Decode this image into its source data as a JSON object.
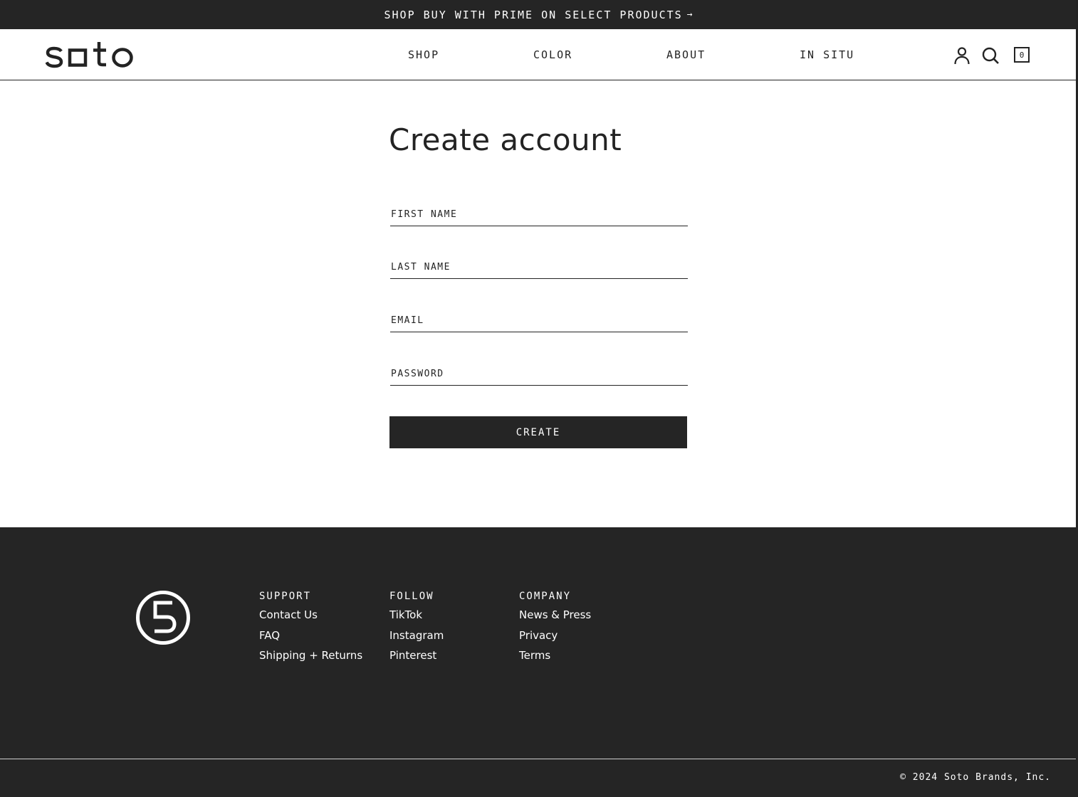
{
  "announcement": {
    "text": "SHOP BUY WITH PRIME ON SELECT PRODUCTS",
    "arrow": "→"
  },
  "header": {
    "logo": "soto",
    "nav": [
      {
        "label": "SHOP"
      },
      {
        "label": "COLOR"
      },
      {
        "label": "ABOUT"
      },
      {
        "label": "IN SITU"
      }
    ],
    "icons": {
      "account": "user-icon",
      "search": "search-icon"
    },
    "cart_count": "0"
  },
  "form": {
    "title": "Create account",
    "first_name_placeholder": "FIRST NAME",
    "last_name_placeholder": "LAST NAME",
    "email_placeholder": "EMAIL",
    "password_placeholder": "PASSWORD",
    "submit_label": "CREATE"
  },
  "footer": {
    "logo_icon": "five-circle-logo-icon",
    "columns": [
      {
        "heading": "SUPPORT",
        "links": [
          "Contact Us",
          "FAQ",
          "Shipping + Returns"
        ]
      },
      {
        "heading": "FOLLOW",
        "links": [
          "TikTok",
          "Instagram",
          "Pinterest"
        ]
      },
      {
        "heading": "COMPANY",
        "links": [
          "News & Press",
          "Privacy",
          "Terms"
        ]
      }
    ],
    "copyright": "© 2024 Soto Brands, Inc."
  },
  "colors": {
    "dark": "#252525",
    "text": "#232323",
    "background": "#ffffff"
  }
}
